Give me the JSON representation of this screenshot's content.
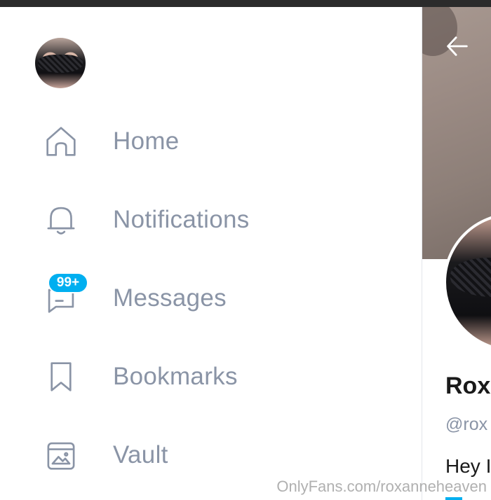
{
  "nav": {
    "items": [
      {
        "label": "Home",
        "icon": "home-icon"
      },
      {
        "label": "Notifications",
        "icon": "bell-icon"
      },
      {
        "label": "Messages",
        "icon": "message-icon",
        "badge": "99+"
      },
      {
        "label": "Bookmarks",
        "icon": "bookmark-icon"
      },
      {
        "label": "Vault",
        "icon": "vault-icon"
      }
    ]
  },
  "profile": {
    "name": "Rox",
    "handle": "@rox",
    "bio": "Hey I"
  },
  "watermark": "OnlyFans.com/roxanneheaven",
  "colors": {
    "nav_text": "#8a94a6",
    "badge": "#00aff0",
    "accent": "#00aff0"
  }
}
